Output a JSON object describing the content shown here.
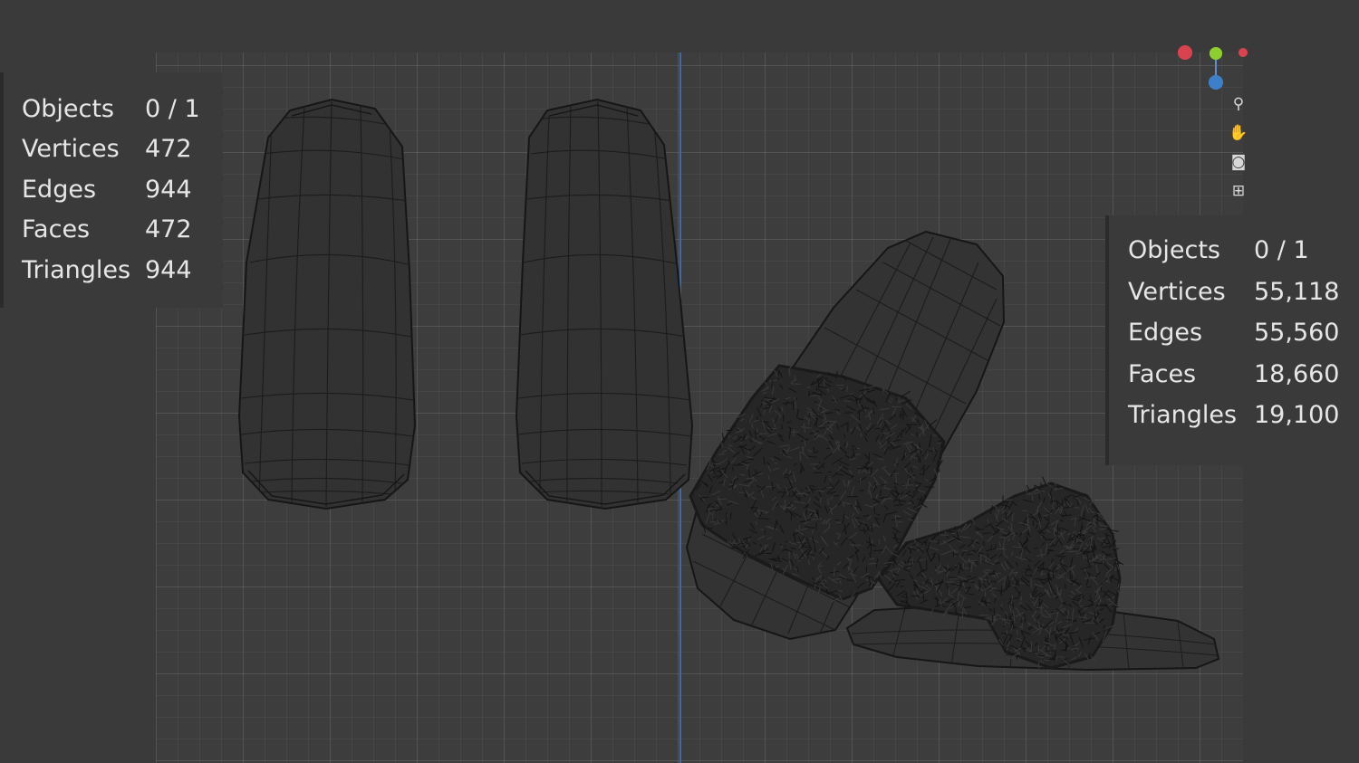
{
  "stats_left": {
    "rows": [
      {
        "label": "Objects",
        "value": "0 / 1"
      },
      {
        "label": "Vertices",
        "value": "472"
      },
      {
        "label": "Edges",
        "value": "944"
      },
      {
        "label": "Faces",
        "value": "472"
      },
      {
        "label": "Triangles",
        "value": "944"
      }
    ]
  },
  "stats_right": {
    "rows": [
      {
        "label": "Objects",
        "value": "0 / 1"
      },
      {
        "label": "Vertices",
        "value": "55,118"
      },
      {
        "label": "Edges",
        "value": "55,560"
      },
      {
        "label": "Faces",
        "value": "18,660"
      },
      {
        "label": "Triangles",
        "value": "19,100"
      }
    ]
  },
  "gizmo": {
    "x_color": "#d9434f",
    "y_color": "#8fce2f",
    "z_color": "#3d7fc9"
  },
  "nav_icons": [
    "zoom-icon",
    "pan-hand-icon",
    "camera-icon",
    "grid-icon"
  ],
  "colors": {
    "background": "#3a3a3a",
    "mesh_fill": "#2f2f2f",
    "wire": "#151515",
    "fur": "#242424",
    "z_axis_line": "#3f6aa8"
  }
}
